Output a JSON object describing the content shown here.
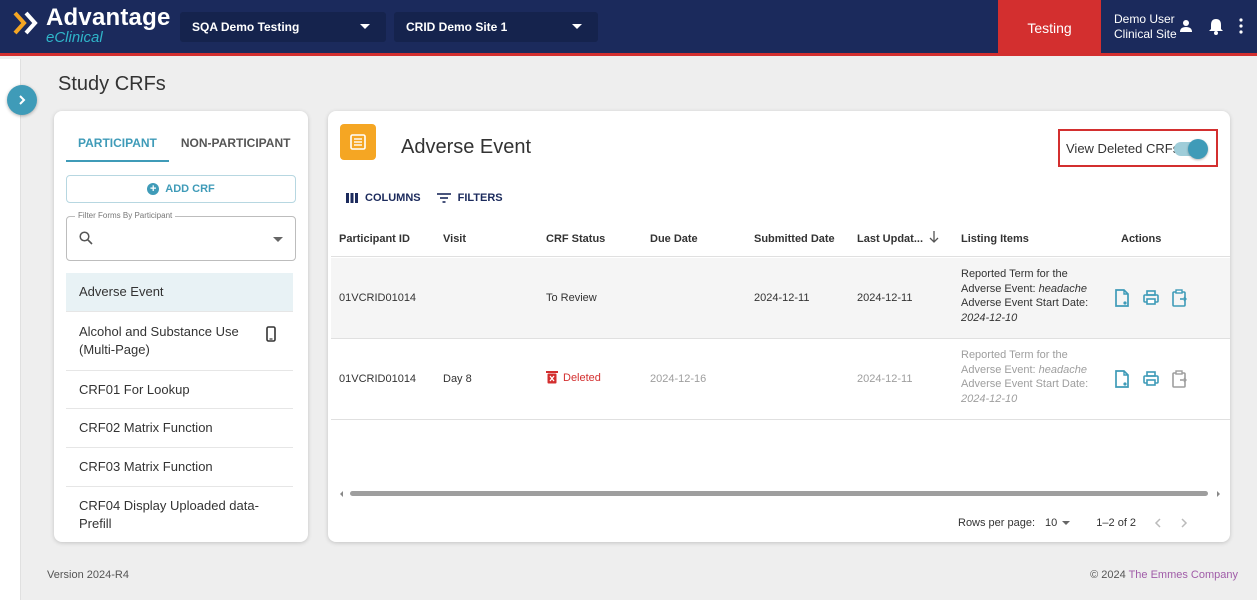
{
  "brand": {
    "name": "Advantage",
    "subtitle": "eClinical"
  },
  "header": {
    "study_select": "SQA Demo Testing",
    "site_select": "CRID Demo Site 1",
    "environment": "Testing",
    "user_name": "Demo User",
    "user_role": "Clinical Site"
  },
  "page": {
    "title": "Study CRFs"
  },
  "forms_panel": {
    "tabs": [
      "PARTICIPANT",
      "NON-PARTICIPANT"
    ],
    "add_crf_label": "ADD CRF",
    "filter_label": "Filter Forms By Participant",
    "items": [
      {
        "label": "Adverse Event"
      },
      {
        "label": "Alcohol and Substance Use (Multi-Page)"
      },
      {
        "label": "CRF01 For Lookup"
      },
      {
        "label": "CRF02 Matrix Function"
      },
      {
        "label": "CRF03 Matrix Function"
      },
      {
        "label": "CRF04 Display Uploaded data-Prefill"
      }
    ]
  },
  "main": {
    "form_title": "Adverse Event",
    "view_deleted_label": "View Deleted CRFs",
    "view_deleted_on": true,
    "toolbar": {
      "columns_label": "COLUMNS",
      "filters_label": "FILTERS"
    },
    "columns": [
      "Participant ID",
      "Visit",
      "CRF Status",
      "Due Date",
      "Submitted Date",
      "Last Updat...",
      "Listing Items",
      "Actions"
    ],
    "rows": [
      {
        "participant_id": "01VCRID01014",
        "visit": "",
        "status": "To Review",
        "due_date": "",
        "submitted_date": "2024-12-11",
        "last_updated": "2024-12-11",
        "listing": {
          "term_label": "Reported Term for the Adverse Event:",
          "term_value": "headache",
          "start_label": "Adverse Event Start Date:",
          "start_value": "2024-12-10"
        }
      },
      {
        "participant_id": "01VCRID01014",
        "visit": "Day 8",
        "status": "Deleted",
        "due_date": "2024-12-16",
        "submitted_date": "",
        "last_updated": "2024-12-11",
        "listing": {
          "term_label": "Reported Term for the Adverse Event:",
          "term_value": "headache",
          "start_label": "Adverse Event Start Date:",
          "start_value": "2024-12-10"
        }
      }
    ],
    "pagination": {
      "rows_per_page_label": "Rows per page:",
      "rows_per_page": "10",
      "range": "1–2 of 2"
    }
  },
  "footer": {
    "version": "Version 2024-R4",
    "copyright": "© 2024",
    "company": "The Emmes Company"
  },
  "colors": {
    "navy": "#1b2a5c",
    "accent": "#3f9bb8",
    "danger": "#d32f2f",
    "orange": "#f5a623"
  }
}
